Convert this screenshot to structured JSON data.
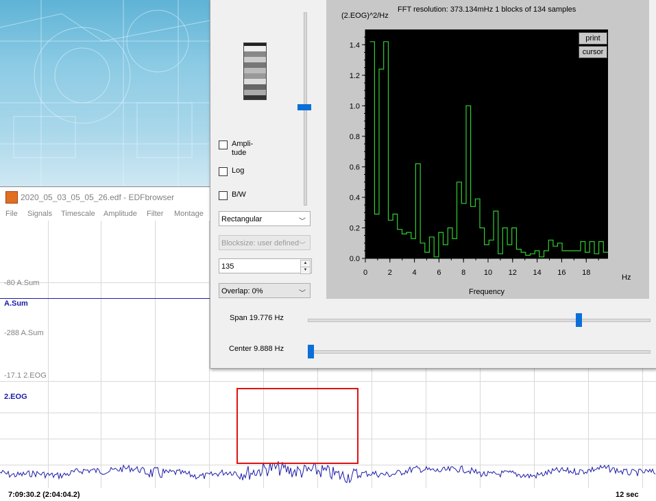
{
  "edf_window": {
    "title": "2020_05_03_05_05_26.edf - EDFbrowser",
    "menu": [
      "File",
      "Signals",
      "Timescale",
      "Amplitude",
      "Filter",
      "Montage"
    ],
    "signals": [
      {
        "offset_label": "-80 A.Sum",
        "name": "A.Sum",
        "bottom_label": "-288 A.Sum"
      },
      {
        "offset_label": "-17.1 2.EOG",
        "name": "2.EOG"
      }
    ],
    "footer_time": "7:09:30.2 (2:04:04.2)",
    "footer_duration": "12 sec",
    "trace_color": "#1a1aa8",
    "highlight_color": "#e01010"
  },
  "spectrum_dialog": {
    "header": "FFT resolution: 373.134mHz   1 blocks of 134 samples",
    "y_unit": "(2.EOG)^2/Hz",
    "checkboxes": [
      {
        "label": "Ampli-\ntude",
        "checked": false
      },
      {
        "label": "Log",
        "checked": false
      },
      {
        "label": "B/W",
        "checked": false
      }
    ],
    "window_select": "Rectangular",
    "blocksize_select": "Blocksize: user defined",
    "samples_value": "135",
    "overlap_select": "Overlap: 0%",
    "buttons": {
      "print": "print",
      "cursor": "cursor"
    },
    "x_axis_label": "Frequency",
    "x_unit": "Hz",
    "span_label": "Span 19.776 Hz",
    "center_label": "Center 9.888 Hz",
    "span_slider_level": 0.8,
    "center_slider_level": 0.0
  },
  "chart_data": {
    "type": "line",
    "title": "",
    "xlabel": "Frequency",
    "ylabel": "(2.EOG)^2/Hz",
    "xlim": [
      0,
      19.776
    ],
    "ylim": [
      0,
      1.5
    ],
    "x_ticks": [
      0,
      2,
      4,
      6,
      8,
      10,
      12,
      14,
      16,
      18
    ],
    "y_ticks": [
      0.0,
      0.2,
      0.4,
      0.6,
      0.8,
      1.0,
      1.2,
      1.4
    ],
    "step": true,
    "line_color": "#30d030",
    "background": "#000000",
    "series": [
      {
        "x": [
          0.37,
          0.75,
          1.12,
          1.49,
          1.87,
          2.24,
          2.61,
          2.99,
          3.36,
          3.73,
          4.1,
          4.48,
          4.85,
          5.22,
          5.6,
          5.97,
          6.34,
          6.72,
          7.09,
          7.46,
          7.84,
          8.21,
          8.58,
          8.96,
          9.33,
          9.7,
          10.07,
          10.45,
          10.82,
          11.19,
          11.57,
          11.94,
          12.31,
          12.69,
          13.06,
          13.43,
          13.81,
          14.18,
          14.55,
          14.93,
          15.3,
          15.67,
          16.04,
          16.42,
          16.79,
          17.16,
          17.54,
          17.91,
          18.28,
          18.66,
          19.03,
          19.4
        ],
        "y": [
          1.42,
          0.29,
          1.24,
          1.42,
          0.25,
          0.29,
          0.19,
          0.16,
          0.17,
          0.13,
          0.62,
          0.1,
          0.04,
          0.14,
          0.01,
          0.17,
          0.09,
          0.2,
          0.13,
          0.5,
          0.36,
          1.0,
          0.34,
          0.39,
          0.2,
          0.09,
          0.12,
          0.31,
          0.03,
          0.2,
          0.09,
          0.2,
          0.06,
          0.04,
          0.02,
          0.03,
          0.05,
          0.01,
          0.05,
          0.12,
          0.08,
          0.1,
          0.05,
          0.05,
          0.05,
          0.05,
          0.11,
          0.04,
          0.11,
          0.03,
          0.11,
          0.04
        ]
      }
    ]
  }
}
